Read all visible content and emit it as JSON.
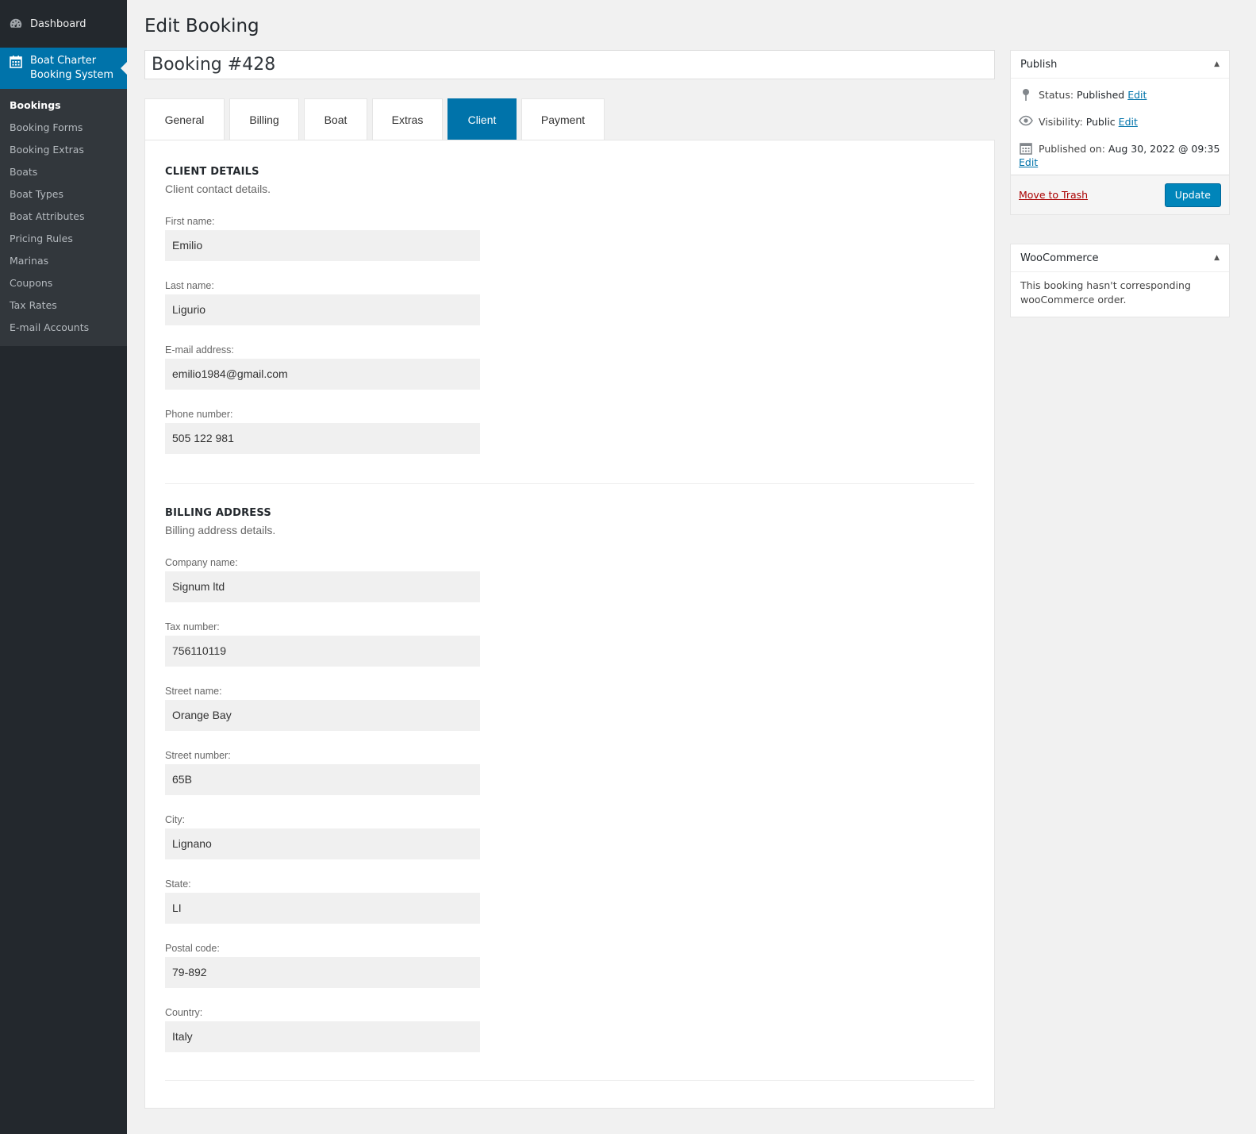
{
  "sidebar": {
    "dashboard": "Dashboard",
    "plugin": "Boat Charter Booking System",
    "plugin_line1": "Boat Charter",
    "plugin_line2": "Booking System",
    "items": [
      {
        "label": "Bookings",
        "current": true
      },
      {
        "label": "Booking Forms"
      },
      {
        "label": "Booking Extras"
      },
      {
        "label": "Boats"
      },
      {
        "label": "Boat Types"
      },
      {
        "label": "Boat Attributes"
      },
      {
        "label": "Pricing Rules"
      },
      {
        "label": "Marinas"
      },
      {
        "label": "Coupons"
      },
      {
        "label": "Tax Rates"
      },
      {
        "label": "E-mail Accounts"
      }
    ]
  },
  "page": {
    "heading": "Edit Booking",
    "title": "Booking #428"
  },
  "tabs": [
    {
      "label": "General"
    },
    {
      "label": "Billing"
    },
    {
      "label": "Boat"
    },
    {
      "label": "Extras"
    },
    {
      "label": "Client",
      "active": true
    },
    {
      "label": "Payment"
    }
  ],
  "client": {
    "heading": "CLIENT DETAILS",
    "desc": "Client contact details.",
    "fields": [
      {
        "label": "First name:",
        "value": "Emilio"
      },
      {
        "label": "Last name:",
        "value": "Ligurio"
      },
      {
        "label": "E-mail address:",
        "value": "emilio1984@gmail.com"
      },
      {
        "label": "Phone number:",
        "value": "505 122 981"
      }
    ]
  },
  "billing": {
    "heading": "BILLING ADDRESS",
    "desc": "Billing address details.",
    "fields": [
      {
        "label": "Company name:",
        "value": "Signum ltd"
      },
      {
        "label": "Tax number:",
        "value": "756110119"
      },
      {
        "label": "Street name:",
        "value": "Orange Bay"
      },
      {
        "label": "Street number:",
        "value": "65B"
      },
      {
        "label": "City:",
        "value": "Lignano"
      },
      {
        "label": "State:",
        "value": "LI"
      },
      {
        "label": "Postal code:",
        "value": "79-892"
      },
      {
        "label": "Country:",
        "value": "Italy"
      }
    ]
  },
  "publish": {
    "title": "Publish",
    "status_label": "Status:",
    "status_value": "Published",
    "visibility_label": "Visibility:",
    "visibility_value": "Public",
    "published_label": "Published on:",
    "published_value": "Aug 30, 2022 @ 09:35",
    "edit": "Edit",
    "trash": "Move to Trash",
    "update": "Update"
  },
  "woocommerce": {
    "title": "WooCommerce",
    "message": "This booking hasn't corresponding wooCommerce order."
  },
  "icons": {
    "dashboard": "dashboard-icon",
    "plugin": "calendar-icon",
    "status": "pin-icon",
    "visibility": "eye-icon",
    "published": "calendar-icon",
    "toggle": "triangle-up-icon"
  },
  "colors": {
    "accent": "#0073aa",
    "sidebar": "#23282d",
    "submenu": "#32373c",
    "trash": "#a00000",
    "button": "#0085ba"
  }
}
